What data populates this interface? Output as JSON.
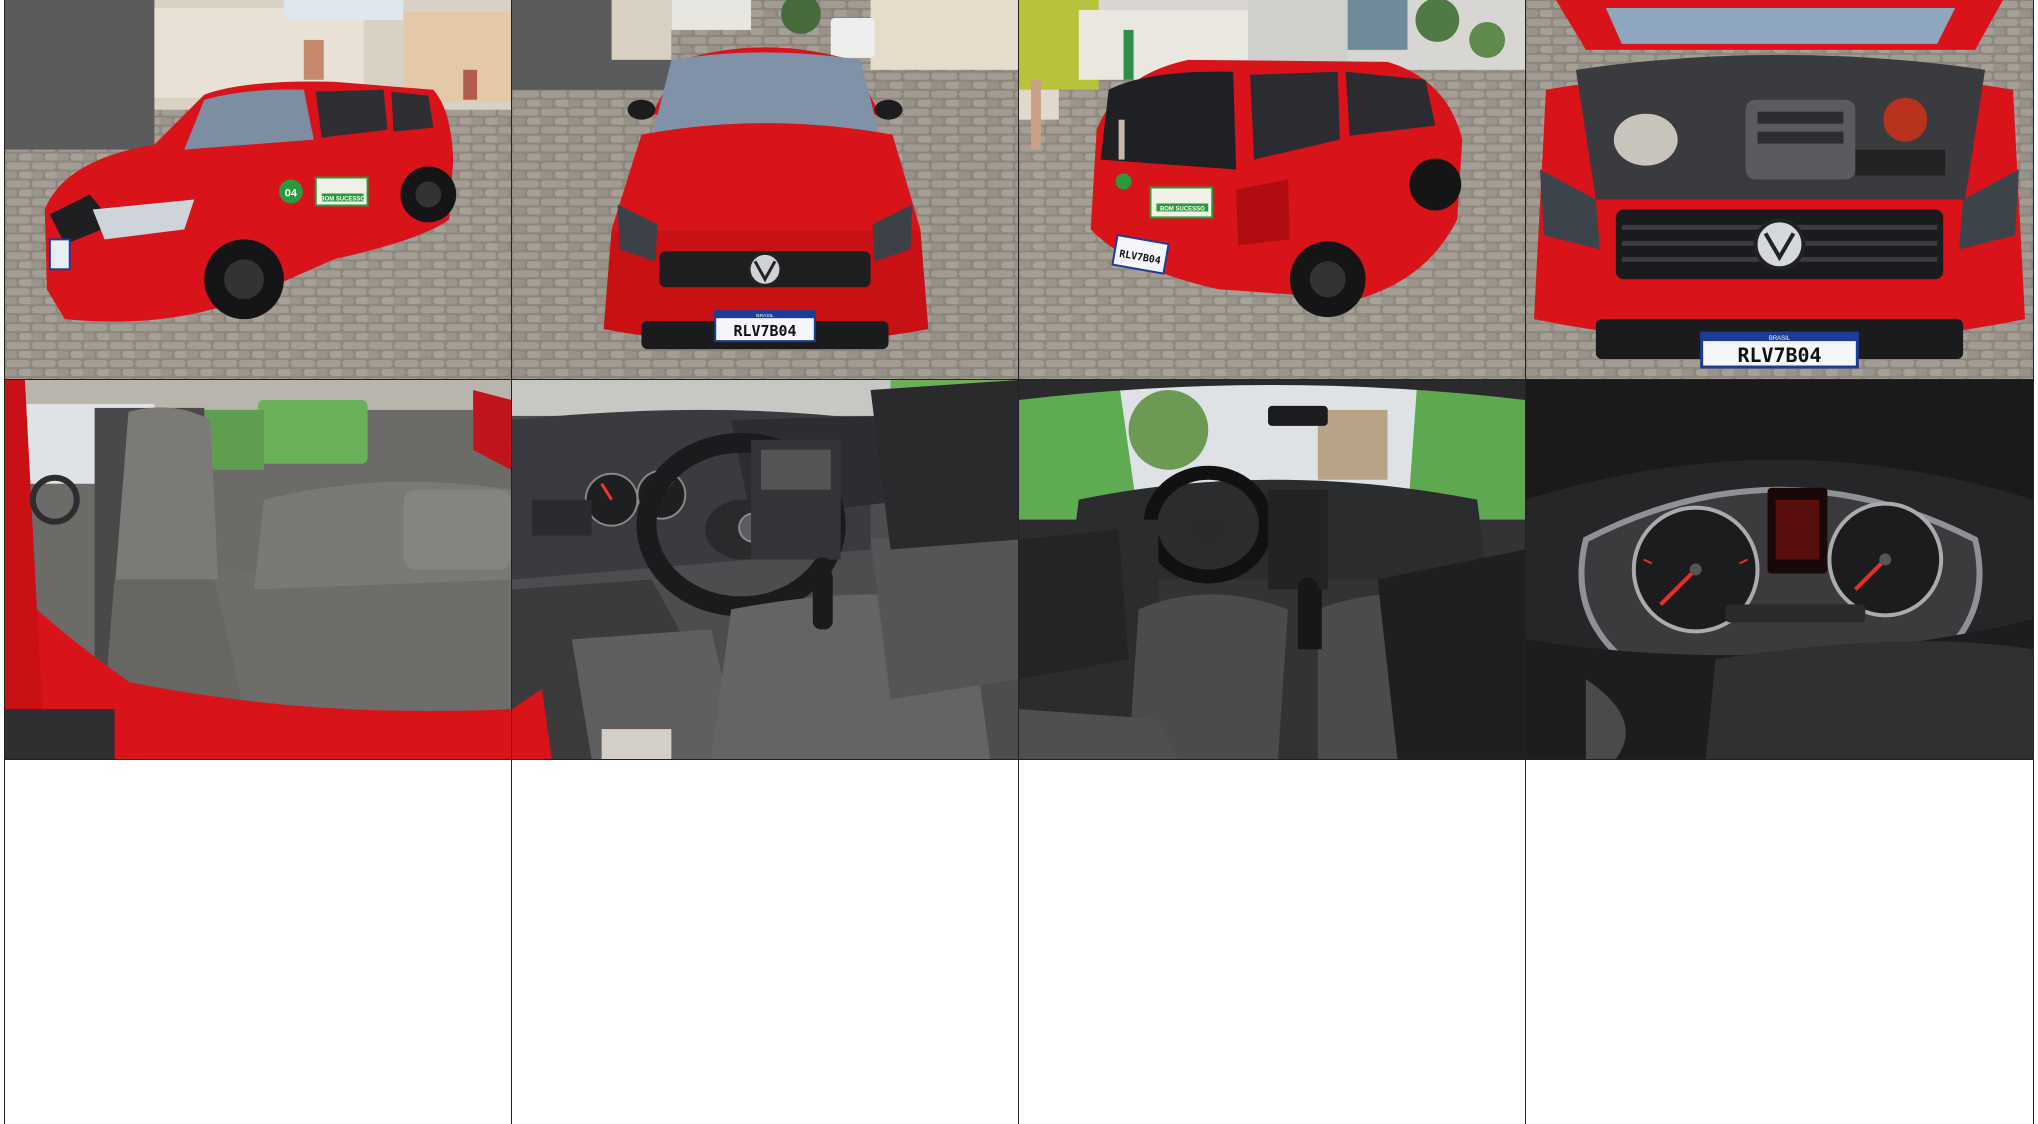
{
  "gallery": {
    "photos": [
      {
        "icon": "red-hatchback-front-three-quarter-photo",
        "badge_text": "04",
        "decal_text": "BOM SUCESSO"
      },
      {
        "icon": "red-hatchback-front-view-photo",
        "plate_country": "BRASIL",
        "plate_text": "RLV7B04"
      },
      {
        "icon": "red-hatchback-rear-three-quarter-photo",
        "decal_text": "BOM SUCESSO",
        "plate_text": "RLV7B04"
      },
      {
        "icon": "open-engine-bay-photo",
        "plate_country": "BRASIL",
        "plate_text": "RLV7B04"
      },
      {
        "icon": "rear-seat-interior-photo"
      },
      {
        "icon": "driver-seat-steering-wheel-photo"
      },
      {
        "icon": "front-cabin-interior-photo"
      },
      {
        "icon": "instrument-cluster-photo"
      }
    ],
    "empty_slots": 4
  },
  "colors": {
    "car_red": "#d8141a",
    "cobblestone": "#8f8a83",
    "interior_gray": "#4a4a4c",
    "plate_blue": "#1c3d96"
  }
}
